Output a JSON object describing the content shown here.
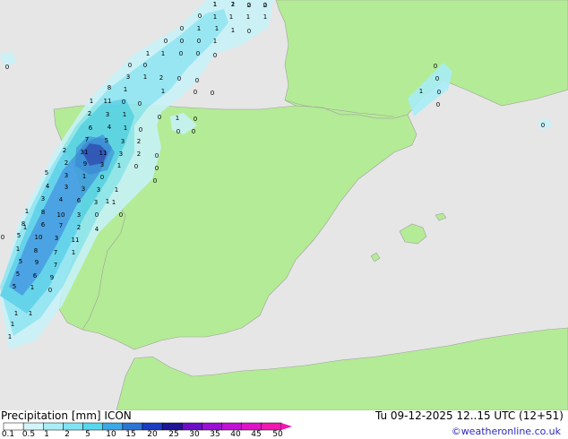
{
  "map": {
    "title_prefix": "Precipitation",
    "units": "[mm]",
    "model": "ICON",
    "valid_time": "Tu 09-12-2025 12..15 UTC (12+51)",
    "credit": "©weatheronline.co.uk",
    "colors": {
      "sea": "#e6e6e6",
      "land": "#b4eb96",
      "border": "#a0a0a0"
    }
  },
  "legend": {
    "ticks": [
      "0.1",
      "0.5",
      "1",
      "2",
      "5",
      "10",
      "15",
      "20",
      "25",
      "30",
      "35",
      "40",
      "45",
      "50"
    ],
    "colors": [
      "#ffffff",
      "#d2f5fa",
      "#a8eef7",
      "#7fe4f2",
      "#56d8ee",
      "#3aa9e8",
      "#2a74d8",
      "#1a3dc4",
      "#1e1696",
      "#6a0fc8",
      "#9b0fd6",
      "#c20fd6",
      "#e012c8",
      "#f018b0"
    ]
  },
  "grid_values": [
    {
      "v": "1"
    },
    {
      "v": "2"
    },
    {
      "v": "2"
    },
    {
      "v": "2"
    },
    {
      "v": "1"
    },
    {
      "v": "1"
    },
    {
      "v": "1"
    },
    {
      "v": "1"
    },
    {
      "v": "0"
    },
    {
      "v": "0"
    },
    {
      "v": "1"
    },
    {
      "v": "1"
    },
    {
      "v": "1"
    },
    {
      "v": "0"
    },
    {
      "v": "0"
    },
    {
      "v": "0"
    },
    {
      "v": "0"
    },
    {
      "v": "1"
    },
    {
      "v": "1"
    },
    {
      "v": "1"
    },
    {
      "v": "0"
    },
    {
      "v": "0"
    },
    {
      "v": "0"
    },
    {
      "v": "0"
    },
    {
      "v": "0"
    },
    {
      "v": "3"
    },
    {
      "v": "1"
    },
    {
      "v": "2"
    },
    {
      "v": "0"
    },
    {
      "v": "0"
    },
    {
      "v": "0"
    },
    {
      "v": "8"
    },
    {
      "v": "1"
    },
    {
      "v": "1"
    },
    {
      "v": "0"
    },
    {
      "v": "0"
    },
    {
      "v": "1"
    },
    {
      "v": "11"
    },
    {
      "v": "0"
    },
    {
      "v": "0"
    },
    {
      "v": "2"
    },
    {
      "v": "3"
    },
    {
      "v": "1"
    },
    {
      "v": "0"
    },
    {
      "v": "1"
    },
    {
      "v": "0"
    },
    {
      "v": "0"
    },
    {
      "v": "6"
    },
    {
      "v": "4"
    },
    {
      "v": "1"
    },
    {
      "v": "0"
    },
    {
      "v": "7"
    },
    {
      "v": "5"
    },
    {
      "v": "3"
    },
    {
      "v": "2"
    },
    {
      "v": "2"
    },
    {
      "v": "31"
    },
    {
      "v": "11"
    },
    {
      "v": "3"
    },
    {
      "v": "2"
    },
    {
      "v": "0"
    },
    {
      "v": "0"
    },
    {
      "v": "9"
    },
    {
      "v": "3"
    },
    {
      "v": "1"
    },
    {
      "v": "0"
    },
    {
      "v": "0"
    },
    {
      "v": "2"
    },
    {
      "v": "5"
    },
    {
      "v": "3"
    },
    {
      "v": "1"
    },
    {
      "v": "0"
    },
    {
      "v": "4"
    },
    {
      "v": "3"
    },
    {
      "v": "3"
    },
    {
      "v": "3"
    },
    {
      "v": "1"
    },
    {
      "v": "3"
    },
    {
      "v": "4"
    },
    {
      "v": "6"
    },
    {
      "v": "3"
    },
    {
      "v": "1"
    },
    {
      "v": "1"
    },
    {
      "v": "8"
    },
    {
      "v": "10"
    },
    {
      "v": "3"
    },
    {
      "v": "0"
    },
    {
      "v": "8"
    },
    {
      "v": "6"
    },
    {
      "v": "7"
    },
    {
      "v": "2"
    },
    {
      "v": "4"
    },
    {
      "v": "5"
    },
    {
      "v": "10"
    },
    {
      "v": "3"
    },
    {
      "v": "11"
    },
    {
      "v": "1"
    },
    {
      "v": "8"
    },
    {
      "v": "7"
    },
    {
      "v": "1"
    },
    {
      "v": "5"
    },
    {
      "v": "9"
    },
    {
      "v": "7"
    },
    {
      "v": "5"
    },
    {
      "v": "6"
    },
    {
      "v": "9"
    },
    {
      "v": "5"
    },
    {
      "v": "1"
    },
    {
      "v": "0"
    },
    {
      "v": "1"
    },
    {
      "v": "0"
    },
    {
      "v": "1"
    },
    {
      "v": "1"
    },
    {
      "v": "1"
    },
    {
      "v": "1"
    },
    {
      "v": "1"
    },
    {
      "v": "0"
    },
    {
      "v": "0"
    },
    {
      "v": "0"
    },
    {
      "v": "0"
    },
    {
      "v": "0"
    },
    {
      "v": "1"
    },
    {
      "v": "0"
    },
    {
      "v": "0"
    },
    {
      "v": "1"
    },
    {
      "v": "1"
    },
    {
      "v": "0"
    },
    {
      "v": "0"
    }
  ]
}
